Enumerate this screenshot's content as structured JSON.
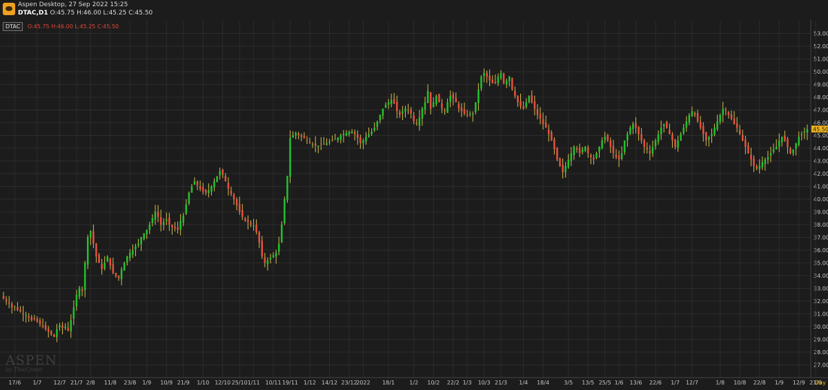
{
  "window": {
    "title": "Aspen Desktop, 27 Sep 2022 15:25",
    "symbol_line": "DTAC,D1",
    "ohlc": "O:45.75 H:46.00 L:45.25 C:45.50"
  },
  "legend": {
    "symbol": "DTAC",
    "values": "O:45.75  H:46.00  L:45.25  C:45.50"
  },
  "watermark": {
    "brand": "ASPEN",
    "by": "by ThaiQuest"
  },
  "colors": {
    "up": "#22c22e",
    "down": "#e8503f",
    "wick": "#d6c24a",
    "background": "#1c1c1c",
    "grid": "#2c2c2c",
    "price_tag": "#f0b419"
  },
  "chart_data": {
    "type": "candlestick",
    "timeframe": "Day",
    "ylim": [
      26,
      54
    ],
    "y_ticks": [
      "27.00",
      "28.00",
      "29.00",
      "30.00",
      "31.00",
      "32.00",
      "33.00",
      "34.00",
      "35.00",
      "36.00",
      "37.00",
      "38.00",
      "39.00",
      "40.00",
      "41.00",
      "42.00",
      "43.00",
      "44.00",
      "45.00",
      "46.00",
      "47.00",
      "48.00",
      "49.00",
      "50.00",
      "51.00",
      "52.00",
      "53.00"
    ],
    "x_ticks": [
      {
        "i": 4,
        "label": "17/6"
      },
      {
        "i": 12,
        "label": "1/7"
      },
      {
        "i": 20,
        "label": "12/7"
      },
      {
        "i": 26,
        "label": "21/7"
      },
      {
        "i": 31,
        "label": "2/8"
      },
      {
        "i": 38,
        "label": "11/8"
      },
      {
        "i": 45,
        "label": "23/8"
      },
      {
        "i": 51,
        "label": "1/9"
      },
      {
        "i": 58,
        "label": "10/9"
      },
      {
        "i": 64,
        "label": "21/9"
      },
      {
        "i": 71,
        "label": "1/10"
      },
      {
        "i": 78,
        "label": "12/10"
      },
      {
        "i": 84,
        "label": "25/10"
      },
      {
        "i": 89,
        "label": "1/11"
      },
      {
        "i": 96,
        "label": "10/11"
      },
      {
        "i": 102,
        "label": "19/11"
      },
      {
        "i": 109,
        "label": "1/12"
      },
      {
        "i": 116,
        "label": "14/12"
      },
      {
        "i": 123,
        "label": "23/12"
      },
      {
        "i": 128,
        "label": "2022"
      },
      {
        "i": 137,
        "label": "18/1"
      },
      {
        "i": 146,
        "label": "1/2"
      },
      {
        "i": 153,
        "label": "10/2"
      },
      {
        "i": 160,
        "label": "22/2"
      },
      {
        "i": 165,
        "label": "1/3"
      },
      {
        "i": 171,
        "label": "10/3"
      },
      {
        "i": 177,
        "label": "21/3"
      },
      {
        "i": 185,
        "label": "1/4"
      },
      {
        "i": 192,
        "label": "18/4"
      },
      {
        "i": 201,
        "label": "3/5"
      },
      {
        "i": 208,
        "label": "13/5"
      },
      {
        "i": 214,
        "label": "25/5"
      },
      {
        "i": 219,
        "label": "1/6"
      },
      {
        "i": 225,
        "label": "13/6"
      },
      {
        "i": 232,
        "label": "22/6"
      },
      {
        "i": 239,
        "label": "1/7"
      },
      {
        "i": 245,
        "label": "12/7"
      },
      {
        "i": 255,
        "label": "1/8"
      },
      {
        "i": 262,
        "label": "10/8"
      },
      {
        "i": 269,
        "label": "22/8"
      },
      {
        "i": 276,
        "label": "1/9"
      },
      {
        "i": 283,
        "label": "12/9"
      },
      {
        "i": 289,
        "label": "21/9"
      }
    ],
    "x_axis_unit": "Day",
    "last_price_label": "45.50",
    "last_price": 45.5,
    "closes": [
      32.2,
      32.0,
      31.8,
      31.5,
      31.6,
      31.3,
      31.2,
      31.0,
      30.9,
      30.7,
      30.5,
      30.6,
      30.4,
      30.2,
      30.0,
      29.8,
      29.6,
      29.4,
      29.2,
      29.8,
      30.1,
      29.9,
      30.0,
      29.7,
      30.5,
      31.5,
      32.5,
      33.0,
      32.8,
      35.0,
      37.0,
      37.5,
      36.5,
      35.5,
      35.0,
      34.5,
      35.0,
      35.5,
      34.8,
      34.2,
      34.0,
      33.8,
      34.5,
      35.0,
      35.5,
      35.8,
      36.0,
      36.3,
      36.5,
      37.0,
      37.3,
      37.6,
      38.0,
      38.5,
      39.0,
      38.6,
      38.0,
      38.2,
      38.4,
      38.0,
      37.8,
      37.7,
      37.6,
      38.3,
      38.7,
      39.6,
      40.5,
      41.0,
      41.4,
      41.1,
      40.8,
      40.6,
      40.5,
      40.7,
      41.0,
      41.4,
      41.8,
      42.2,
      41.9,
      41.4,
      40.8,
      40.4,
      40.0,
      39.5,
      39.0,
      38.6,
      38.3,
      38.2,
      38.0,
      37.9,
      37.4,
      36.6,
      35.5,
      35.0,
      35.2,
      35.4,
      35.6,
      35.8,
      36.5,
      38.0,
      40.0,
      41.8,
      44.8,
      45.0,
      45.2,
      45.0,
      44.9,
      44.8,
      44.6,
      44.4,
      44.3,
      44.2,
      44.2,
      44.3,
      44.3,
      44.4,
      44.5,
      44.6,
      44.7,
      44.8,
      45.0,
      45.1,
      45.2,
      45.3,
      45.3,
      45.1,
      44.8,
      44.4,
      44.6,
      44.9,
      45.1,
      45.3,
      45.6,
      46.1,
      46.6,
      47.1,
      47.4,
      47.6,
      47.8,
      47.5,
      46.9,
      46.6,
      46.9,
      47.1,
      47.0,
      46.7,
      46.1,
      45.9,
      46.4,
      47.1,
      47.6,
      48.5,
      47.1,
      47.6,
      48.1,
      47.6,
      47.1,
      46.9,
      47.6,
      48.1,
      47.9,
      47.6,
      47.1,
      46.9,
      46.7,
      46.6,
      46.7,
      46.7,
      47.6,
      48.6,
      49.6,
      49.9,
      49.6,
      49.3,
      49.1,
      49.1,
      49.6,
      49.9,
      49.1,
      49.3,
      49.6,
      48.6,
      48.1,
      47.6,
      47.3,
      47.1,
      47.6,
      48.1,
      47.6,
      47.1,
      46.6,
      46.3,
      45.9,
      45.6,
      45.1,
      44.6,
      43.9,
      43.1,
      42.6,
      42.1,
      42.6,
      43.1,
      43.6,
      44.1,
      43.9,
      43.6,
      43.9,
      44.1,
      43.6,
      43.3,
      43.1,
      43.6,
      44.1,
      44.6,
      44.9,
      44.6,
      44.1,
      43.6,
      43.3,
      43.1,
      43.6,
      44.6,
      45.1,
      45.6,
      45.9,
      45.6,
      45.1,
      44.6,
      44.1,
      43.9,
      43.6,
      44.1,
      44.6,
      45.1,
      45.6,
      45.9,
      45.6,
      45.1,
      44.6,
      44.1,
      44.6,
      45.1,
      45.6,
      46.1,
      46.6,
      46.9,
      46.6,
      46.1,
      45.6,
      45.1,
      44.6,
      44.9,
      45.1,
      45.6,
      46.1,
      46.6,
      47.1,
      46.9,
      46.6,
      46.3,
      45.9,
      45.6,
      45.1,
      44.6,
      44.1,
      43.6,
      43.1,
      42.6,
      42.4,
      42.6,
      42.9,
      43.1,
      43.3,
      43.6,
      43.9,
      44.1,
      44.6,
      44.9,
      44.6,
      44.1,
      43.6,
      43.9,
      44.4,
      44.9,
      45.1,
      45.3,
      45.5
    ]
  }
}
